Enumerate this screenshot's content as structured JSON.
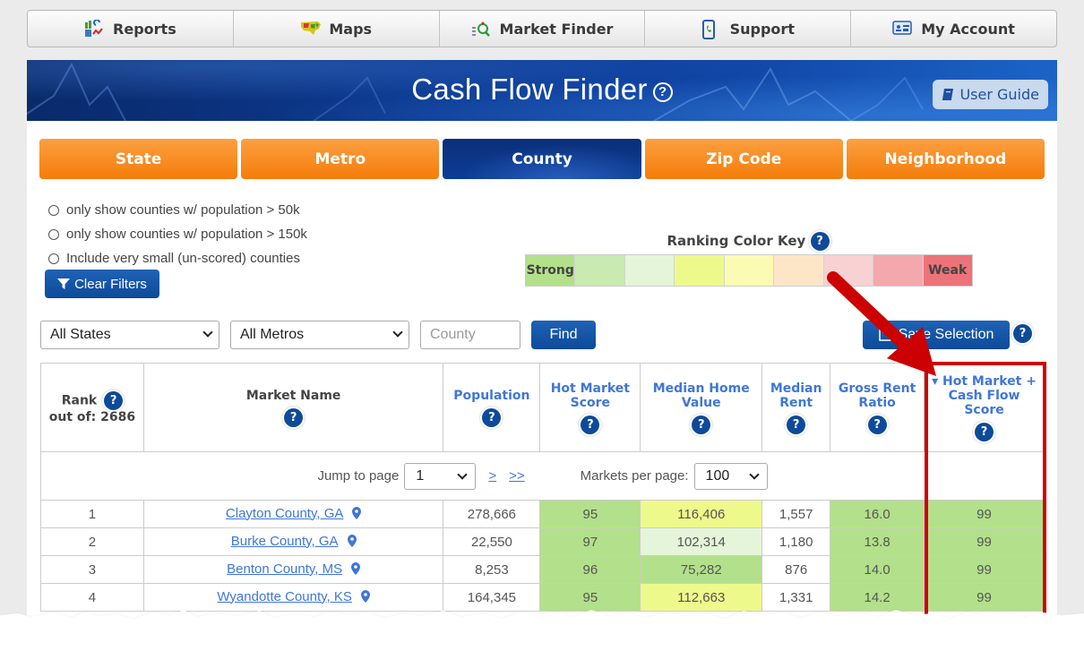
{
  "topnav": {
    "items": [
      {
        "label": "Reports",
        "icon": "reports-chart-icon"
      },
      {
        "label": "Maps",
        "icon": "us-map-icon"
      },
      {
        "label": "Market Finder",
        "icon": "market-finder-icon"
      },
      {
        "label": "Support",
        "icon": "phone-icon"
      },
      {
        "label": "My Account",
        "icon": "account-card-icon"
      }
    ]
  },
  "banner": {
    "title": "Cash Flow Finder",
    "help_glyph": "?",
    "user_guide_label": "User Guide"
  },
  "level_tabs": [
    {
      "label": "State",
      "active": false
    },
    {
      "label": "Metro",
      "active": false
    },
    {
      "label": "County",
      "active": true
    },
    {
      "label": "Zip Code",
      "active": false
    },
    {
      "label": "Neighborhood",
      "active": false
    }
  ],
  "filters": {
    "options": [
      {
        "label": "only show counties w/ population > 50k",
        "checked": false
      },
      {
        "label": "only show counties w/ population > 150k",
        "checked": false
      },
      {
        "label": "Include very small (un-scored) counties",
        "checked": false
      }
    ],
    "clear_label": "Clear Filters"
  },
  "color_key": {
    "title": "Ranking Color Key",
    "strong_label": "Strong",
    "weak_label": "Weak",
    "colors": [
      "#b3e08a",
      "#c9eab0",
      "#e4f5d9",
      "#eef98c",
      "#fbfbb3",
      "#fde6c8",
      "#f8d1d3",
      "#f3a8ad",
      "#ec7379"
    ]
  },
  "search": {
    "state_select": "All States",
    "metro_select": "All Metros",
    "county_placeholder": "County",
    "find_label": "Find",
    "save_label": "Save Selection"
  },
  "table": {
    "columns": [
      {
        "label": "Rank",
        "sub": "out of: 2686"
      },
      {
        "label": "Market Name"
      },
      {
        "label": "Population"
      },
      {
        "label": "Hot Market Score"
      },
      {
        "label": "Median Home Value"
      },
      {
        "label": "Median Rent"
      },
      {
        "label": "Gross Rent Ratio"
      },
      {
        "label": "Hot Market + Cash Flow Score",
        "sorted": "desc",
        "sort_glyph": "▾"
      }
    ],
    "pager": {
      "jump_label": "Jump to page",
      "page_value": "1",
      "next_label": ">",
      "last_label": ">>",
      "per_page_label": "Markets per page:",
      "per_page_value": "100"
    },
    "rows": [
      {
        "rank": "1",
        "name": "Clayton County, GA",
        "population": "278,666",
        "hot_score": "95",
        "home_value": "116,406",
        "rent": "1,557",
        "grr": "16.0",
        "combined": "99",
        "colors": {
          "hot_score": "#b3e08a",
          "home_value": "#eef98c",
          "rent": "#ffffff",
          "grr": "#b3e08a",
          "combined": "#b3e08a"
        }
      },
      {
        "rank": "2",
        "name": "Burke County, GA",
        "population": "22,550",
        "hot_score": "97",
        "home_value": "102,314",
        "rent": "1,180",
        "grr": "13.8",
        "combined": "99",
        "colors": {
          "hot_score": "#b3e08a",
          "home_value": "#e4f5d9",
          "rent": "#ffffff",
          "grr": "#b3e08a",
          "combined": "#b3e08a"
        }
      },
      {
        "rank": "3",
        "name": "Benton County, MS",
        "population": "8,253",
        "hot_score": "96",
        "home_value": "75,282",
        "rent": "876",
        "grr": "14.0",
        "combined": "99",
        "colors": {
          "hot_score": "#b3e08a",
          "home_value": "#b3e08a",
          "rent": "#ffffff",
          "grr": "#b3e08a",
          "combined": "#b3e08a"
        }
      },
      {
        "rank": "4",
        "name": "Wyandotte County, KS",
        "population": "164,345",
        "hot_score": "95",
        "home_value": "112,663",
        "rent": "1,331",
        "grr": "14.2",
        "combined": "99",
        "colors": {
          "hot_score": "#b3e08a",
          "home_value": "#eef98c",
          "rent": "#ffffff",
          "grr": "#b3e08a",
          "combined": "#b3e08a"
        }
      }
    ]
  },
  "annotation": {
    "arrow_color": "#cc0000",
    "box_color": "#cc0000"
  }
}
